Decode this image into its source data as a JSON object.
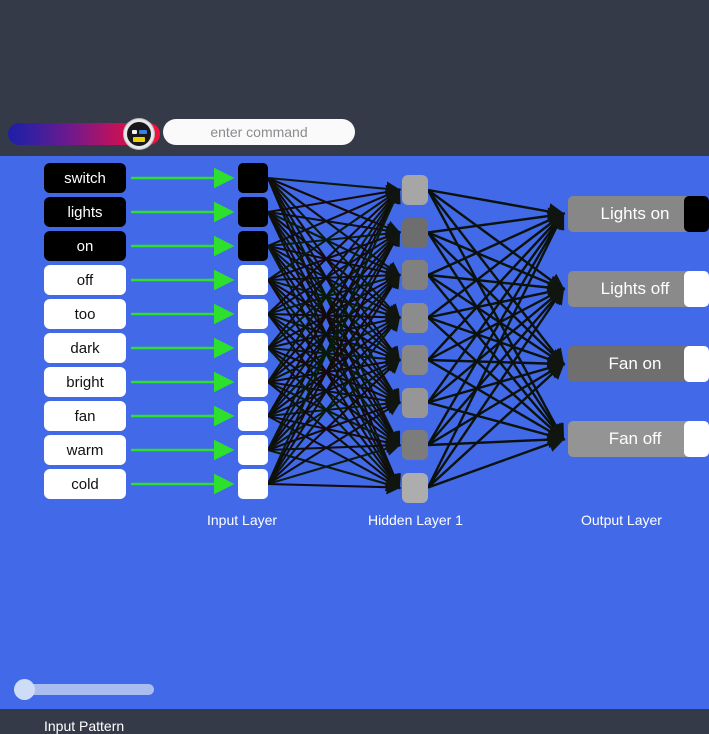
{
  "toolbar": {
    "gradient_slider": {
      "name": "mood-gradient-slider",
      "value_position_pct": 78,
      "gradient_from": "#1d1fa8",
      "gradient_mid": "#6d1a8e",
      "gradient_to": "#f5113c",
      "thumb_icon": "robot-face-icon"
    },
    "command_input": {
      "placeholder": "enter command",
      "value": ""
    }
  },
  "canvas": {
    "background_color": "#4169e8",
    "arrow_color": "#2ee02e"
  },
  "input_layer": {
    "caption": "Input Layer",
    "words": [
      {
        "label": "switch",
        "active": true
      },
      {
        "label": "lights",
        "active": true
      },
      {
        "label": "on",
        "active": true
      },
      {
        "label": "off",
        "active": false
      },
      {
        "label": "too",
        "active": false
      },
      {
        "label": "dark",
        "active": false
      },
      {
        "label": "bright",
        "active": false
      },
      {
        "label": "fan",
        "active": false
      },
      {
        "label": "warm",
        "active": false
      },
      {
        "label": "cold",
        "active": false
      }
    ]
  },
  "hidden_layer": {
    "caption": "Hidden Layer 1",
    "nodes": [
      {
        "activation": 0.34,
        "color": "#a6a6a6"
      },
      {
        "activation": 0.62,
        "color": "#6e6e6e"
      },
      {
        "activation": 0.52,
        "color": "#808080"
      },
      {
        "activation": 0.45,
        "color": "#8c8c8c"
      },
      {
        "activation": 0.48,
        "color": "#888888"
      },
      {
        "activation": 0.4,
        "color": "#969696"
      },
      {
        "activation": 0.55,
        "color": "#7c7c7c"
      },
      {
        "activation": 0.3,
        "color": "#adadad"
      }
    ]
  },
  "output_layer": {
    "caption": "Output Layer",
    "outputs": [
      {
        "label": "Lights on",
        "bar_color": "#878787",
        "fired": true
      },
      {
        "label": "Lights off",
        "bar_color": "#8a8a8a",
        "fired": false
      },
      {
        "label": "Fan on",
        "bar_color": "#6f6f6f",
        "fired": false
      },
      {
        "label": "Fan off",
        "bar_color": "#949494",
        "fired": false
      }
    ]
  },
  "pattern_slider": {
    "label": "Input Pattern",
    "value_position_pct": 0
  }
}
